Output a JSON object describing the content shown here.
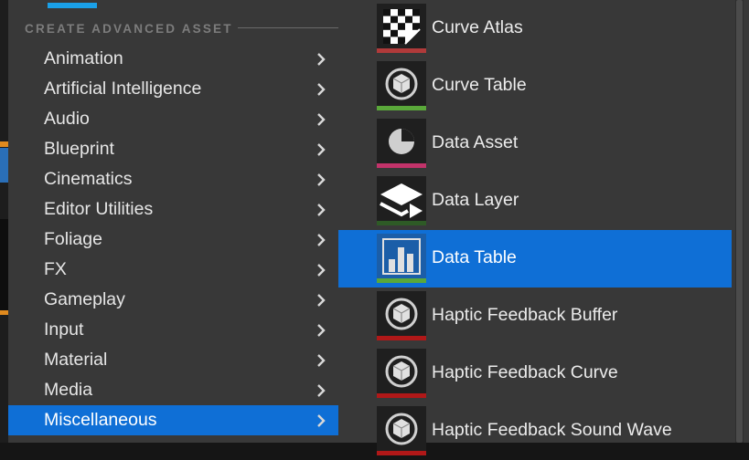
{
  "left_menu": {
    "section_title": "CREATE ADVANCED ASSET",
    "items": [
      {
        "label": "Animation"
      },
      {
        "label": "Artificial Intelligence"
      },
      {
        "label": "Audio"
      },
      {
        "label": "Blueprint"
      },
      {
        "label": "Cinematics"
      },
      {
        "label": "Editor Utilities"
      },
      {
        "label": "Foliage"
      },
      {
        "label": "FX"
      },
      {
        "label": "Gameplay"
      },
      {
        "label": "Input"
      },
      {
        "label": "Material"
      },
      {
        "label": "Media"
      },
      {
        "label": "Miscellaneous",
        "selected": true
      }
    ]
  },
  "right_menu": {
    "items": [
      {
        "label": "Curve Atlas",
        "icon": "checker-icon",
        "color": "#b03a3a"
      },
      {
        "label": "Curve Table",
        "icon": "cube-icon",
        "color": "#5aa83a"
      },
      {
        "label": "Data Asset",
        "icon": "pie-icon",
        "color": "#c2336a"
      },
      {
        "label": "Data Layer",
        "icon": "layers-icon",
        "color": "#2e5a26"
      },
      {
        "label": "Data Table",
        "icon": "bar-chart-icon",
        "color": "#5aa83a",
        "selected": true
      },
      {
        "label": "Haptic Feedback Buffer",
        "icon": "cube-icon",
        "color": "#b01818"
      },
      {
        "label": "Haptic Feedback Curve",
        "icon": "cube-icon",
        "color": "#b01818"
      },
      {
        "label": "Haptic Feedback Sound Wave",
        "icon": "cube-icon",
        "color": "#b01818"
      }
    ]
  },
  "colors": {
    "selection": "#0f6fd6",
    "menu_bg": "#383838",
    "text": "#e6e6e6",
    "section_title": "#7c7c7c"
  }
}
